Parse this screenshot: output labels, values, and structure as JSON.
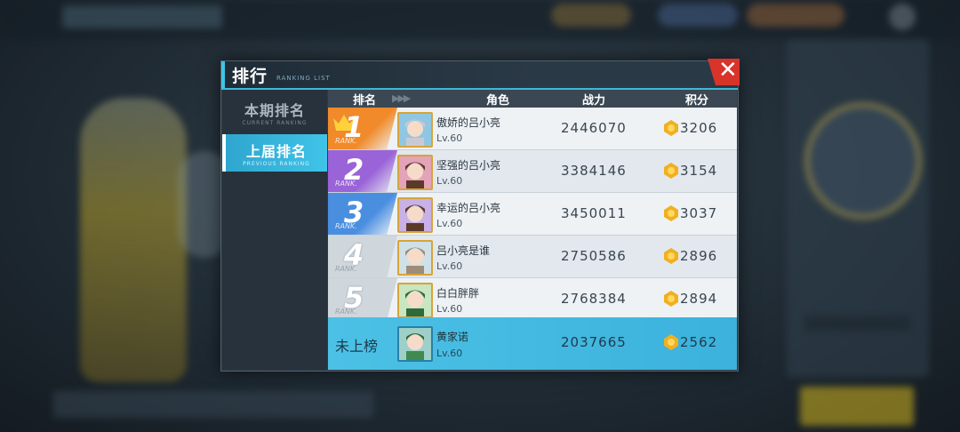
{
  "modal": {
    "title": "排行",
    "subtitle": "RANKING LIST",
    "close_symbol": "✕"
  },
  "sidebar": {
    "tabs": [
      {
        "label": "本期排名",
        "sub": "CURRENT RANKING",
        "active": false
      },
      {
        "label": "上届排名",
        "sub": "PREVIOUS RANKING",
        "active": true
      }
    ]
  },
  "table": {
    "headers": {
      "rank": "排名",
      "role": "角色",
      "power": "战力",
      "score": "积分"
    },
    "rank_tag": "RANK.",
    "rows": [
      {
        "rank": "1",
        "name": "傲娇的吕小亮",
        "level": "Lv.60",
        "power": "2446070",
        "score": "3206",
        "badge_color": "#f08a2a"
      },
      {
        "rank": "2",
        "name": "坚强的吕小亮",
        "level": "Lv.60",
        "power": "3384146",
        "score": "3154",
        "badge_color": "#9a63d8"
      },
      {
        "rank": "3",
        "name": "幸运的吕小亮",
        "level": "Lv.60",
        "power": "3450011",
        "score": "3037",
        "badge_color": "#4a8ee0"
      },
      {
        "rank": "4",
        "name": "吕小亮是谁",
        "level": "Lv.60",
        "power": "2750586",
        "score": "2896",
        "badge_color": "#cfd6dc"
      },
      {
        "rank": "5",
        "name": "白白胖胖",
        "level": "Lv.60",
        "power": "2768384",
        "score": "2894",
        "badge_color": "#cfd6dc"
      }
    ],
    "self": {
      "rank": "未上榜",
      "name": "黄家诺",
      "level": "Lv.60",
      "power": "2037665",
      "score": "2562"
    }
  },
  "colors": {
    "accent": "#3fc4e8",
    "close": "#d9342a",
    "gold": "#f0b020"
  },
  "icons": {
    "close": "close-icon",
    "crown": "crown-icon",
    "medal": "medal-icon"
  }
}
